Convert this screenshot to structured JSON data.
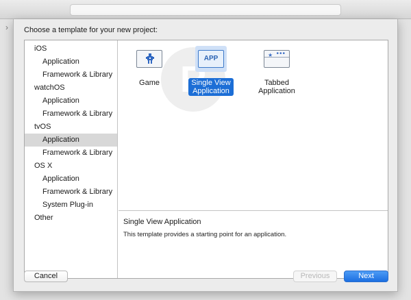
{
  "sheet": {
    "title": "Choose a template for your new project:"
  },
  "sidebar": {
    "items": [
      {
        "label": "iOS",
        "level": "group"
      },
      {
        "label": "Application",
        "level": "child"
      },
      {
        "label": "Framework & Library",
        "level": "child"
      },
      {
        "label": "watchOS",
        "level": "group"
      },
      {
        "label": "Application",
        "level": "child"
      },
      {
        "label": "Framework & Library",
        "level": "child"
      },
      {
        "label": "tvOS",
        "level": "group"
      },
      {
        "label": "Application",
        "level": "child",
        "selected": true
      },
      {
        "label": "Framework & Library",
        "level": "child"
      },
      {
        "label": "OS X",
        "level": "group"
      },
      {
        "label": "Application",
        "level": "child"
      },
      {
        "label": "Framework & Library",
        "level": "child"
      },
      {
        "label": "System Plug-in",
        "level": "child"
      },
      {
        "label": "Other",
        "level": "group"
      }
    ]
  },
  "templates": [
    {
      "label": "Game",
      "icon": "game-sprite-icon"
    },
    {
      "label": "Single View\nApplication",
      "icon_text": "APP",
      "selected": true
    },
    {
      "label": "Tabbed\nApplication",
      "icon": "tab-bar-icon"
    }
  ],
  "description": {
    "title": "Single View Application",
    "text": "This template provides a starting point for an application."
  },
  "buttons": {
    "cancel": "Cancel",
    "previous": "Previous",
    "next": "Next"
  },
  "colors": {
    "accent": "#1c6ed6",
    "selection_gray": "#d8d8d8"
  }
}
